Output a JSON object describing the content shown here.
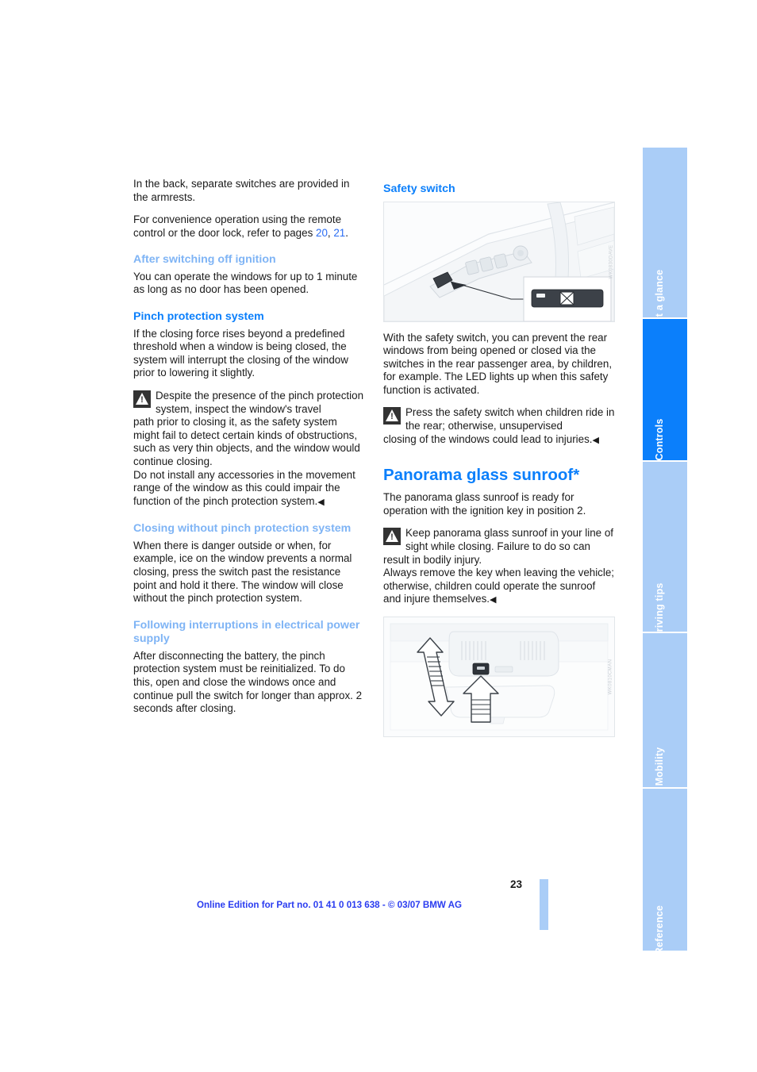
{
  "page": {
    "number": "23",
    "footer_note": "Online Edition for Part no. 01 41 0 013 638 - © 03/07 BMW AG"
  },
  "side_tabs": [
    {
      "label": "At a glance",
      "active": false
    },
    {
      "label": "Controls",
      "active": true
    },
    {
      "label": "Driving tips",
      "active": false
    },
    {
      "label": "Mobility",
      "active": false
    },
    {
      "label": "Reference",
      "active": false
    }
  ],
  "left_column": {
    "intro_1": "In the back, separate switches are provided in the armrests.",
    "intro_2_pre": "For convenience operation using the remote control or the door lock, refer to pages ",
    "xref_20": "20",
    "xref_sep": ", ",
    "xref_21": "21",
    "intro_2_post": ".",
    "heading_ignition": "After switching off ignition",
    "body_ignition": "You can operate the windows for up to 1 minute as long as no door has been opened.",
    "heading_pinch": "Pinch protection system",
    "body_pinch": "If the closing force rises beyond a predefined threshold when a window is being closed, the system will interrupt the closing of the window prior to lowering it slightly.",
    "note_pinch_lead": "Despite the presence of the pinch protection system, inspect the window's travel",
    "note_pinch_rest": "path prior to closing it, as the safety system might fail to detect certain kinds of obstructions, such as very thin objects, and the window would continue closing.",
    "note_pinch_rest2": "Do not install any accessories in the movement range of the window as this could impair the function of the pinch protection system.",
    "heading_closing": "Closing without pinch protection system",
    "body_closing": "When there is danger outside or when, for example, ice on the window prevents a normal closing, press the switch past the resistance point and hold it there. The window will close without the pinch protection system.",
    "heading_power": "Following interruptions in electrical power supply",
    "body_power": "After disconnecting the battery, the pinch protection system must be reinitialized. To do this, open and close the windows once and continue pull the switch for longer than approx. 2 seconds after closing."
  },
  "right_column": {
    "heading_safety": "Safety switch",
    "figure_door_code": "WK0830DAVE",
    "body_safety": "With the safety switch, you can prevent the rear windows from being opened or closed via the switches in the rear passenger area, by children, for example. The LED lights up when this safety function is activated.",
    "note_safety_lead": "Press the safety switch when children ride in the rear; otherwise, unsupervised",
    "note_safety_rest": "closing of the windows could lead to injuries.",
    "title_sunroof": "Panorama glass sunroof*",
    "body_sunroof": "The panorama glass sunroof is ready for operation with the ignition key in position 2.",
    "note_sunroof_lead": "Keep panorama glass sunroof in your line of sight while closing. Failure to do so can",
    "note_sunroof_rest": "result in bodily injury.",
    "note_sunroof_rest2": "Always remove the key when leaving the vehicle; otherwise, children could operate the sunroof and injure themselves.",
    "figure_roof_code": "WK0810CMAN"
  },
  "colors": {
    "heading_blue": "#0b7ffb",
    "heading_light_blue": "#7fb4f5",
    "tab_inactive": "#aacdf7",
    "tab_active": "#0b7ffb",
    "xref_blue": "#2a6df4",
    "footer_blue": "#2a3cf0"
  },
  "endmark": "◀"
}
